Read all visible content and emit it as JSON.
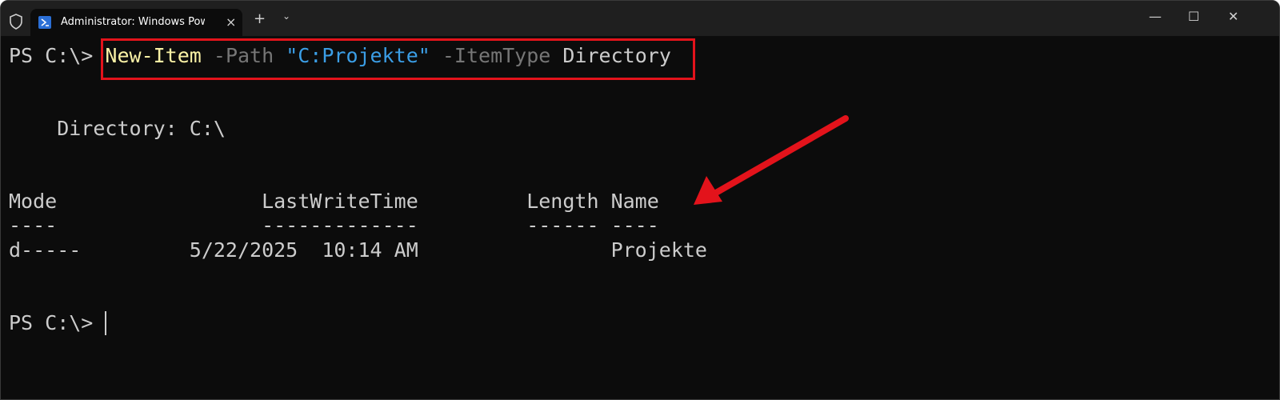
{
  "window": {
    "tab_title": "Administrator: Windows PowerShell",
    "new_tab_symbol": "+",
    "dropdown_symbol": "⌄",
    "close_tab_symbol": "×",
    "minimize_symbol": "—",
    "maximize_symbol": "☐",
    "close_symbol": "✕"
  },
  "terminal": {
    "prompt": "PS C:\\> ",
    "command": {
      "cmdlet": "New-Item",
      "param1": " -Path ",
      "value1": "\"C:Projekte\"",
      "param2": " -ItemType ",
      "value2": "Directory"
    },
    "directory_line": "    Directory: C:\\",
    "header_line": "Mode                 LastWriteTime         Length Name",
    "separator_line": "----                 -------------         ------ ----",
    "rows": [
      "d-----         5/22/2025  10:14 AM                Projekte"
    ],
    "final_prompt": "PS C:\\> "
  },
  "colors": {
    "annotation": "#e3131b",
    "cmdlet": "#f9f1a5",
    "parameter": "#767676",
    "string": "#3b9ee6"
  }
}
